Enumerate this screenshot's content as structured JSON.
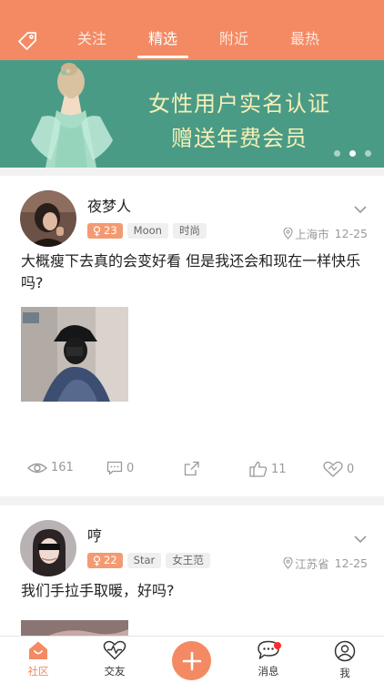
{
  "header": {
    "tabs": [
      {
        "label": "关注"
      },
      {
        "label": "精选"
      },
      {
        "label": "附近"
      },
      {
        "label": "最热"
      }
    ],
    "active_tab": "精选"
  },
  "banner": {
    "line1": "女性用户实名认证",
    "line2": "赠送年费会员",
    "active_dot": 1
  },
  "posts": [
    {
      "username": "夜梦人",
      "age": "23",
      "tags": [
        "Moon",
        "时尚"
      ],
      "location": "上海市",
      "date": "12-25",
      "content": "大概瘦下去真的会变好看 但是我还会和现在一样快乐吗?",
      "views": "161",
      "comments": "0",
      "likes": "11",
      "gifts": "0"
    },
    {
      "username": "哼",
      "age": "22",
      "tags": [
        "Star",
        "女王范"
      ],
      "location": "江苏省",
      "date": "12-25",
      "content": "我们手拉手取暖，好吗?"
    }
  ],
  "bottom_nav": {
    "items": [
      {
        "label": "社区"
      },
      {
        "label": "交友"
      },
      {
        "label": "消息"
      },
      {
        "label": "我"
      }
    ]
  },
  "colors": {
    "accent": "#f38a63",
    "banner_bg": "#4a9b86",
    "banner_text": "#f6efb7"
  }
}
